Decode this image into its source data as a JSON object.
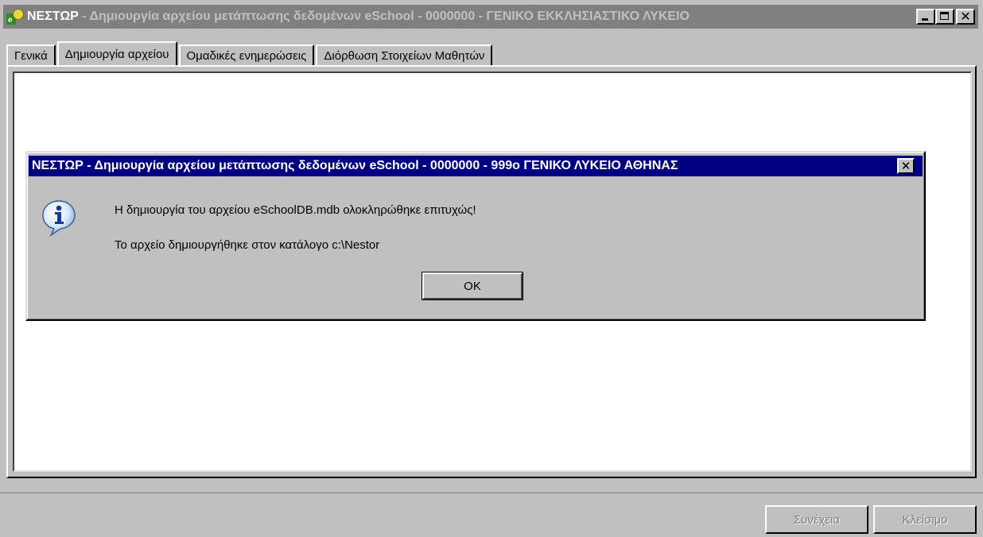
{
  "window": {
    "title_name": "ΝΕΣΤΩΡ",
    "title_rest": " - Δημιουργία αρχείου μετάπτωσης δεδομένων eSchool - 0000000 - ΓΕΝΙΚΟ ΕΚΚΛΗΣΙΑΣΤΙΚΟ ΛΥΚΕΙΟ",
    "caption_buttons": [
      "minimize-icon",
      "maximize-icon",
      "close-icon"
    ]
  },
  "tabs": [
    {
      "label": "Γενικά",
      "active": false
    },
    {
      "label": "Δημιουργία αρχείου",
      "active": true
    },
    {
      "label": "Ομαδικές ενημερώσεις",
      "active": false
    },
    {
      "label": "Διόρθωση Στοιχείων Μαθητών",
      "active": false
    }
  ],
  "dialog": {
    "title": "ΝΕΣΤΩΡ - Δημιουργία αρχείου μετάπτωσης δεδομένων eSchool - 0000000 -  999ο ΓΕΝΙΚΟ ΛΥΚΕΙΟ ΑΘΗΝΑΣ",
    "icon": "info-icon",
    "message_line1": "Η δημιουργία του αρχείου eSchoolDB.mdb ολοκληρώθηκε επιτυχώς!",
    "message_line2": "Το αρχείο δημιουργήθηκε στον κατάλογο c:\\Nestor",
    "ok_label": "OK"
  },
  "footer": {
    "continue_label": "Συνέχεια",
    "close_label": "Κλείσιμο"
  },
  "colors": {
    "face": "#c0c0c0",
    "inactive_title": "#808080",
    "active_title": "#000080"
  }
}
